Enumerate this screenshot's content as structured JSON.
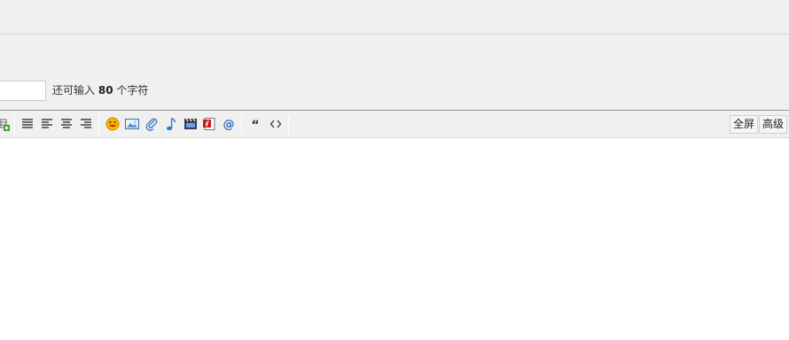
{
  "subject": {
    "value": "",
    "remaining_prefix": "还可输入",
    "remaining_count": "80",
    "remaining_suffix": "个字符"
  },
  "toolbar": {
    "buttons": [
      {
        "icon": "insert-table-icon"
      },
      {
        "icon": "align-justify-icon"
      },
      {
        "icon": "align-left-icon"
      },
      {
        "icon": "align-center-icon"
      },
      {
        "icon": "align-right-icon"
      },
      {
        "icon": "emoticon-icon"
      },
      {
        "icon": "image-icon"
      },
      {
        "icon": "attachment-icon"
      },
      {
        "icon": "music-icon"
      },
      {
        "icon": "video-icon"
      },
      {
        "icon": "flash-icon"
      },
      {
        "icon": "at-mention-icon"
      },
      {
        "icon": "quote-icon"
      },
      {
        "icon": "code-icon"
      }
    ],
    "fullscreen_label": "全屏",
    "advanced_label": "高级"
  },
  "editor": {
    "content": ""
  }
}
